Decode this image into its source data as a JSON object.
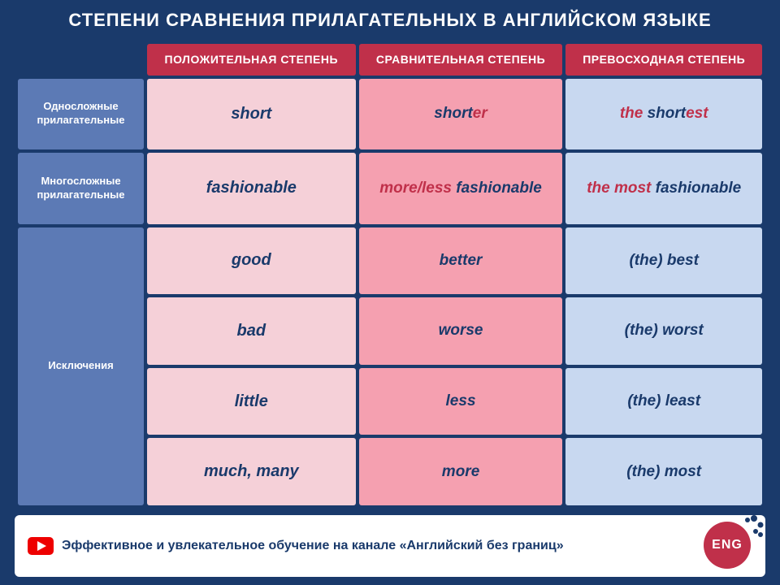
{
  "title": "СТЕПЕНИ СРАВНЕНИЯ ПРИЛАГАТЕЛЬНЫХ В АНГЛИЙСКОМ ЯЗЫКЕ",
  "headers": {
    "col0": "",
    "col1": "ПОЛОЖИТЕЛЬНАЯ СТЕПЕНЬ",
    "col2": "СРАВНИТЕЛЬНАЯ СТЕПЕНЬ",
    "col3": "ПРЕВОСХОДНАЯ СТЕПЕНЬ"
  },
  "rows": [
    {
      "label": "Односложные прилагательные",
      "positive": "short",
      "comparative": "shorter",
      "superlative": "the shortest",
      "type": "one-syllable"
    },
    {
      "label": "Многосложные прилагательные",
      "positive": "fashionable",
      "comparative": "more/less fashionable",
      "superlative": "the most fashionable",
      "type": "multi-syllable"
    },
    {
      "label": "Исключения",
      "exceptions": [
        {
          "positive": "good",
          "comparative": "better",
          "superlative": "(the) best"
        },
        {
          "positive": "bad",
          "comparative": "worse",
          "superlative": "(the) worst"
        },
        {
          "positive": "little",
          "comparative": "less",
          "superlative": "(the) least"
        },
        {
          "positive": "much, many",
          "comparative": "more",
          "superlative": "(the) most"
        }
      ]
    }
  ],
  "footer": {
    "text": "Эффективное и увлекательное обучение на канале «Английский без границ»",
    "logo": "ENG"
  }
}
